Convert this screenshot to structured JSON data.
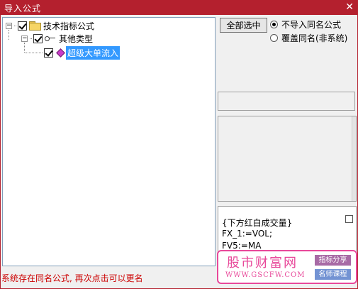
{
  "window": {
    "title": "导入公式",
    "close_glyph": "✕"
  },
  "tree": {
    "root": {
      "label": "技术指标公式",
      "expander": "−",
      "checked": true
    },
    "group": {
      "label": "其他类型",
      "expander": "−",
      "checked": true
    },
    "leaf": {
      "label": "超级大单流入",
      "checked": true,
      "selected": true
    }
  },
  "controls": {
    "select_all": "全部选中",
    "radio_skip": "不导入同名公式",
    "radio_overwrite": "覆盖同名(非系统)",
    "selected_option": "radio_skip"
  },
  "code": {
    "lines": [
      "{下方红白成交量}",
      "FX_1:=VOL;",
      "FV5:=MA"
    ]
  },
  "status": "系统存在同名公式, 再次点击可以更名",
  "watermark": {
    "brand": "股市财富网",
    "url": "WWW.GSCFW.COM",
    "tag1": "指标分享",
    "tag2": "名师课程"
  },
  "colors": {
    "titlebar": "#b4202e",
    "selection": "#3399ff",
    "status": "#cc0000",
    "watermark": "#e8489a"
  }
}
